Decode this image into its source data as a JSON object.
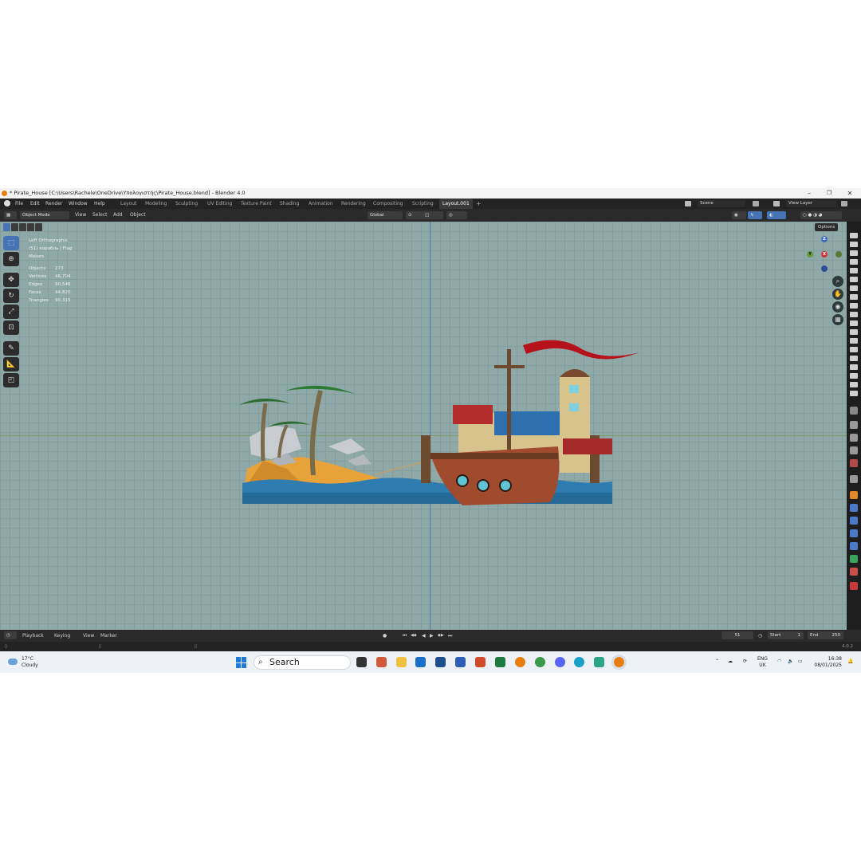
{
  "window": {
    "title": "* Pirate_House [C:\\Users\\Rachele\\OneDrive\\Υπολογιστής\\Pirate_House.blend] - Blender 4.0",
    "minimize_glyph": "–",
    "maximize_glyph": "❐",
    "close_glyph": "✕"
  },
  "menu": [
    "File",
    "Edit",
    "Render",
    "Window",
    "Help"
  ],
  "workspaces": [
    "Layout",
    "Modeling",
    "Sculpting",
    "UV Editing",
    "Texture Paint",
    "Shading",
    "Animation",
    "Rendering",
    "Compositing",
    "Scripting",
    "Layout.001"
  ],
  "add_workspace_glyph": "+",
  "scene": {
    "name": "Scene"
  },
  "view_layer": {
    "name": "View Layer"
  },
  "header": {
    "mode": "Object Mode",
    "menus": [
      "View",
      "Select",
      "Add",
      "Object"
    ],
    "orientation": "Global",
    "options_label": "Options"
  },
  "viewport": {
    "view_name": "Left Orthographic",
    "active": "(51) корабль | Flag",
    "units": "Meters",
    "stats": [
      {
        "label": "Objects",
        "value": "273"
      },
      {
        "label": "Vertices",
        "value": "46,704"
      },
      {
        "label": "Edges",
        "value": "90,546"
      },
      {
        "label": "Faces",
        "value": "44,820"
      },
      {
        "label": "Triangles",
        "value": "90,315"
      }
    ],
    "gizmo": {
      "z": "Z",
      "y": "Y",
      "x": "X"
    },
    "colors": {
      "background": "#8fa8a8",
      "grid": "#849d9d",
      "x_axis": "#c8373d",
      "y_axis": "#6a9a3b",
      "z_axis": "#3d6ac4"
    }
  },
  "timeline": {
    "menus": [
      "Playback",
      "Keying",
      "View",
      "Marker"
    ],
    "current_frame": "51",
    "start_label": "Start",
    "start_value": "1",
    "end_label": "End",
    "end_value": "250",
    "transport_glyphs": [
      "⏮",
      "◀◆",
      "◀",
      "▶",
      "◆▶",
      "⏭"
    ]
  },
  "statusbar": {
    "version": "4.0.2"
  },
  "taskbar": {
    "weather_temp": "17°C",
    "weather_text": "Cloudy",
    "search_placeholder": "Search",
    "lang_line1": "ENG",
    "lang_line2": "UK",
    "time": "16:38",
    "date": "08/01/2025"
  }
}
